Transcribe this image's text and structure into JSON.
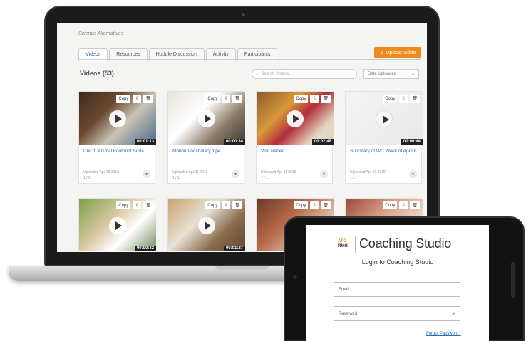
{
  "app": {
    "header": "Science Alternatives",
    "tabs": [
      "Videos",
      "Resources",
      "Huddle Discussion",
      "Activity",
      "Participants"
    ],
    "upload_label": "Upload Video"
  },
  "videos": {
    "title": "Videos (53)",
    "search_placeholder": "Search Videos...",
    "sort_label": "Date Uploaded",
    "actions": {
      "copy": "Copy"
    },
    "cards": [
      {
        "title": "Unit 1: Animal Footprint Sorta...",
        "duration": "00:01:13",
        "meta": "Uploaded Apr 18 2019",
        "stats": "1 / 0"
      },
      {
        "title": "Motion Vocabulary.mp4",
        "duration": "00:00:34",
        "meta": "Uploaded Apr 11 2019",
        "stats": "1 / 1"
      },
      {
        "title": "Visit Rader",
        "duration": "00:02:48",
        "meta": "Uploaded Apr 11 2019",
        "stats": "7 / 1"
      },
      {
        "title": "Summary of WC Week of April 8",
        "duration": "00:00:44",
        "meta": "Uploaded Apr 10 2019",
        "stats": "1 / 1"
      },
      {
        "title": "",
        "duration": "00:00:42",
        "meta": "",
        "stats": ""
      },
      {
        "title": "",
        "duration": "00:01:27",
        "meta": "",
        "stats": ""
      },
      {
        "title": "",
        "duration": "",
        "meta": "",
        "stats": ""
      },
      {
        "title": "",
        "duration": "",
        "meta": "",
        "stats": ""
      }
    ]
  },
  "login": {
    "brand_top": "ATO",
    "brand_bottom": "RMH",
    "brand_name": "Coaching Studio",
    "title": "Login to Coaching Studio",
    "email_placeholder": "Email",
    "password_placeholder": "Password",
    "forgot": "Forgot Password?"
  },
  "colors": {
    "accent": "#f08a1d",
    "link": "#2b6cc4"
  }
}
